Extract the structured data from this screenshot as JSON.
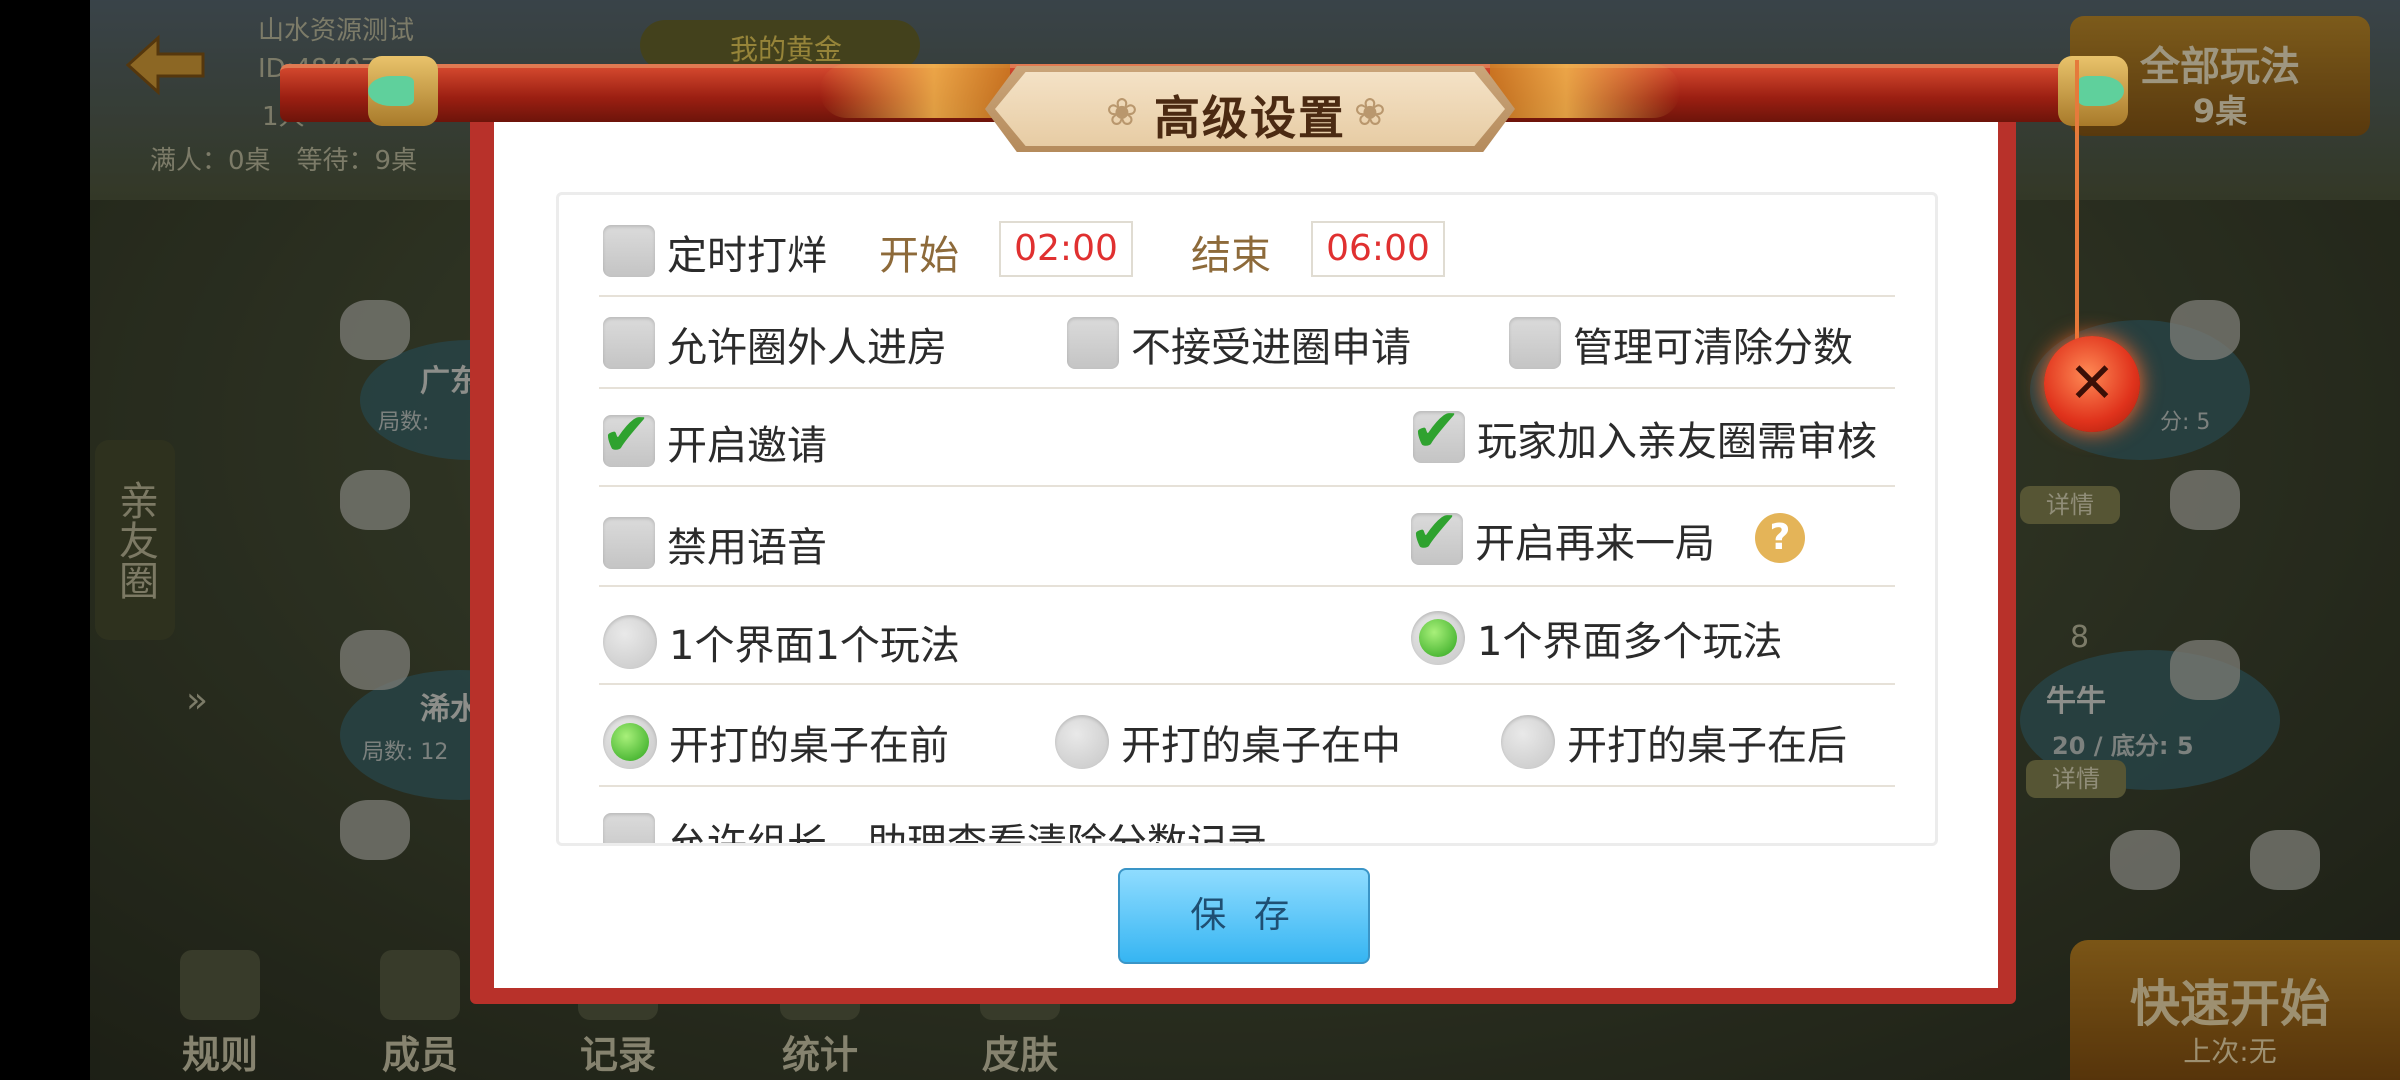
{
  "background": {
    "room_name": "山水资源测试",
    "room_id": "ID:48497",
    "member_count": "1人",
    "status_line": "满人：0桌　等待：9桌",
    "gold_label": "我的黄金",
    "all_modes_title": "全部玩法",
    "all_modes_count": "9桌",
    "quick_start": "快速开始",
    "quick_start_sub": "上次:无",
    "side_tab": "亲友圈",
    "bottom_nav": [
      "规则",
      "成员",
      "记录",
      "统计",
      "皮肤"
    ],
    "table_left_title": "广东",
    "table_left_sub": "局数:",
    "table_left2_title": "浠水",
    "table_left2_sub": "局数: 12",
    "table_right_title": "牛牛",
    "table_right_sub": "20 / 底分: 5",
    "table_right_top_sub": "分: 5",
    "table_right_seat": "8",
    "detail_label": "详情"
  },
  "dialog": {
    "title": "高级设置",
    "timed_close": {
      "label": "定时打烊",
      "checked": false,
      "start_label": "开始",
      "start_value": "02:00",
      "end_label": "结束",
      "end_value": "06:00"
    },
    "row2": [
      {
        "label": "允许圈外人进房",
        "checked": false
      },
      {
        "label": "不接受进圈申请",
        "checked": false
      },
      {
        "label": "管理可清除分数",
        "checked": false
      }
    ],
    "row3": [
      {
        "label": "开启邀请",
        "checked": true
      },
      {
        "label": "玩家加入亲友圈需审核",
        "checked": true
      }
    ],
    "row4": [
      {
        "label": "禁用语音",
        "checked": false
      },
      {
        "label": "开启再来一局",
        "checked": true,
        "help": "?"
      }
    ],
    "layout_mode": [
      {
        "label": "1个界面1个玩法",
        "selected": false
      },
      {
        "label": "1个界面多个玩法",
        "selected": true
      }
    ],
    "table_order": [
      {
        "label": "开打的桌子在前",
        "selected": true
      },
      {
        "label": "开打的桌子在中",
        "selected": false
      },
      {
        "label": "开打的桌子在后",
        "selected": false
      }
    ],
    "row7": {
      "label": "允许组长、助理查看清除分数记录",
      "checked": false
    },
    "save_label": "保 存",
    "close_symbol": "✕"
  },
  "colors": {
    "frame_red": "#b8312a",
    "check_green": "#2fa22f",
    "time_red": "#e03030",
    "save_blue": "#36b5f2"
  }
}
